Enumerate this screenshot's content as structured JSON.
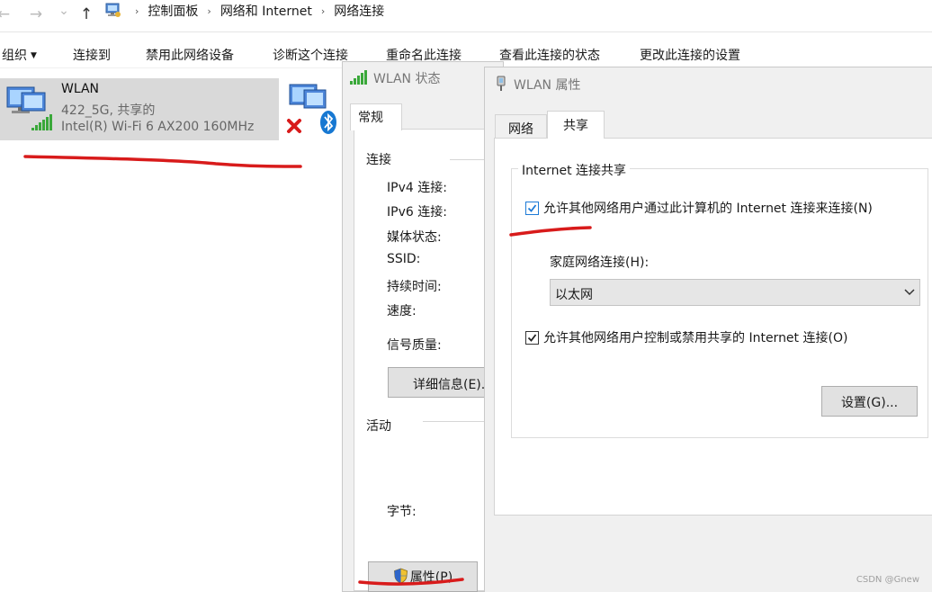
{
  "address_bar": {
    "back_glyph": "←",
    "forward_glyph": "→",
    "expand_glyph": "⌄",
    "up_glyph": "↑",
    "breadcrumb_separator": "›",
    "breadcrumbs": [
      "控制面板",
      "网络和 Internet",
      "网络连接"
    ]
  },
  "toolbar": {
    "organize": "组织",
    "items": [
      "连接到",
      "禁用此网络设备",
      "诊断这个连接",
      "重命名此连接",
      "查看此连接的状态",
      "更改此连接的设置"
    ]
  },
  "adapter": {
    "name": "WLAN",
    "network": "422_5G, 共享的",
    "device": "Intel(R) Wi-Fi 6 AX200 160MHz"
  },
  "status_dialog": {
    "title": "WLAN 状态",
    "tab": "常规",
    "connection_group": "连接",
    "fields": [
      "IPv4 连接:",
      "IPv6 连接:",
      "媒体状态:",
      "SSID:",
      "持续时间:",
      "速度:"
    ],
    "signal_label": "信号质量:",
    "details_button": "详细信息(E)...",
    "activity_group": "活动",
    "bytes_label": "字节:",
    "properties_button": "属性(P)"
  },
  "properties_dialog": {
    "title": "WLAN 属性",
    "tabs": [
      "网络",
      "共享"
    ],
    "active_tab": "共享",
    "group_title": "Internet 连接共享",
    "allow_sharing": {
      "label": "允许其他网络用户通过此计算机的 Internet 连接来连接(N)",
      "checked": true
    },
    "home_network_label": "家庭网络连接(H):",
    "home_network_value": "以太网",
    "allow_control": {
      "label": "允许其他网络用户控制或禁用共享的 Internet 连接(O)",
      "checked": true
    },
    "settings_button": "设置(G)..."
  },
  "watermark": "CSDN @Gnew",
  "colors": {
    "annotation_red": "#d81b1b",
    "checkbox_blue": "#1e7bd7",
    "signal_green": "#3aa83a",
    "tile_bg": "#d9d9d9",
    "dialog_bg": "#f0f0f0"
  }
}
